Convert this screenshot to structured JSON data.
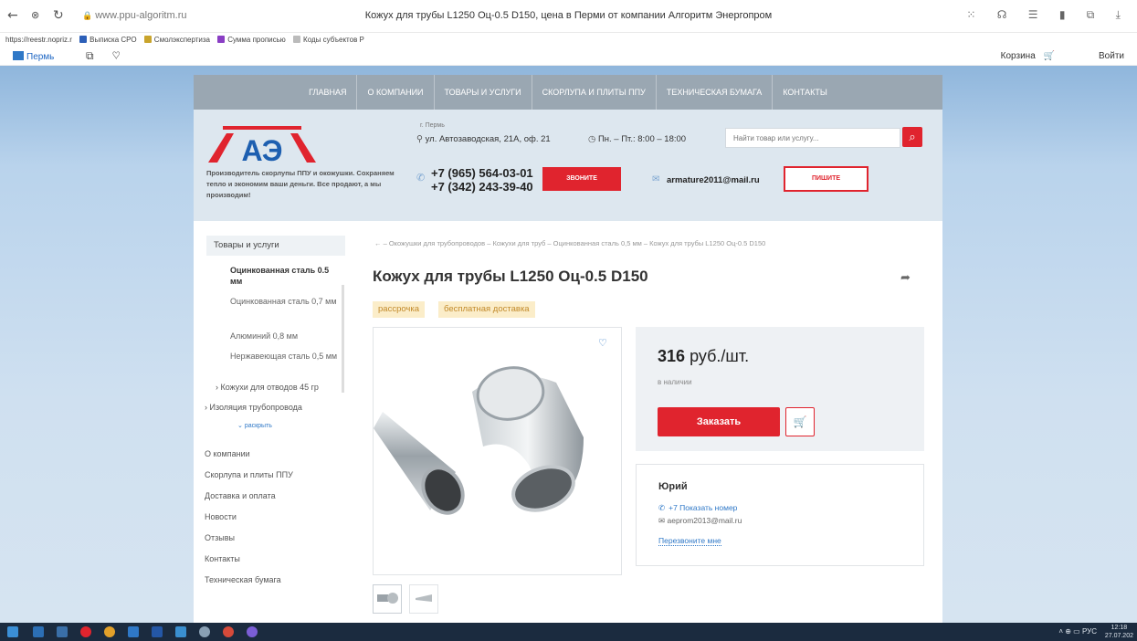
{
  "browser": {
    "url": "www.ppu-algoritm.ru",
    "tab_title": "Кожух для трубы L1250 Оц-0.5 D150, цена в Перми от компании Алгоритм Энергопром",
    "bookmarks": [
      "https://reestr.nopriz.r",
      "Выписка СРО",
      "Смолэкспертиза",
      "Сумма прописью",
      "Коды субъектов Р"
    ]
  },
  "topbar": {
    "city": "Пермь",
    "cart": "Корзина",
    "login": "Войти"
  },
  "menu": [
    "Главная",
    "О компании",
    "Товары и услуги",
    "Скорлупа и плиты ППУ",
    "Техническая бумага",
    "Контакты"
  ],
  "header": {
    "logo_text": "АЭ",
    "slogan": "Производитель скорлупы ППУ и окожушки. Сохраняем тепло и экономим ваши деньги. Все продают, а мы производим!",
    "city_small": "г. Пермь",
    "address": "ул. Автозаводская, 21А, оф. 21",
    "hours": "Пн. – Пт.: 8:00 – 18:00",
    "search_placeholder": "Найти товар или услугу...",
    "phone1": "+7 (965) 564-03-01",
    "phone2": "+7 (342) 243-39-40",
    "call_btn": "Звоните",
    "email": "armature2011@mail.ru",
    "write_btn": "Пишите"
  },
  "sidebar": {
    "head": "Товары и услуги",
    "sub": [
      "Оцинкованная сталь 0.5 мм",
      "Оцинкованная сталь 0,7 мм",
      "Алюминий 0,8 мм",
      "Нержавеющая сталь 0,5 мм"
    ],
    "expand1": "Кожухи для отводов 45 гр",
    "expand2": "Изоляция трубопровода",
    "more": "раскрыть",
    "links": [
      "О компании",
      "Скорлупа и плиты ППУ",
      "Доставка и оплата",
      "Новости",
      "Отзывы",
      "Контакты",
      "Техническая бумага"
    ]
  },
  "breadcrumb": "←  –  Окожушки для трубопроводов  –  Кожухи для труб  –  Оцинкованная сталь 0,5 мм  –  Кожух для трубы L1250 Оц-0.5 D150",
  "product": {
    "title": "Кожух для трубы L1250 Оц-0.5 D150",
    "tags": [
      "рассрочка",
      "бесплатная доставка"
    ],
    "price": "316",
    "unit": "руб./шт.",
    "stock": "в наличии",
    "order_btn": "Заказать"
  },
  "seller": {
    "name": "Юрий",
    "phone": "+7 Показать номер",
    "email": "aeprom2013@mail.ru",
    "callback": "Перезвоните мне"
  },
  "taskbar": {
    "lang": "РУС",
    "time": "12:18",
    "date": "27.07.202"
  },
  "colors": {
    "accent": "#e0242e",
    "link": "#2f78c7",
    "menu": "#9aa7b2",
    "tag_bg": "#fbedc9"
  }
}
